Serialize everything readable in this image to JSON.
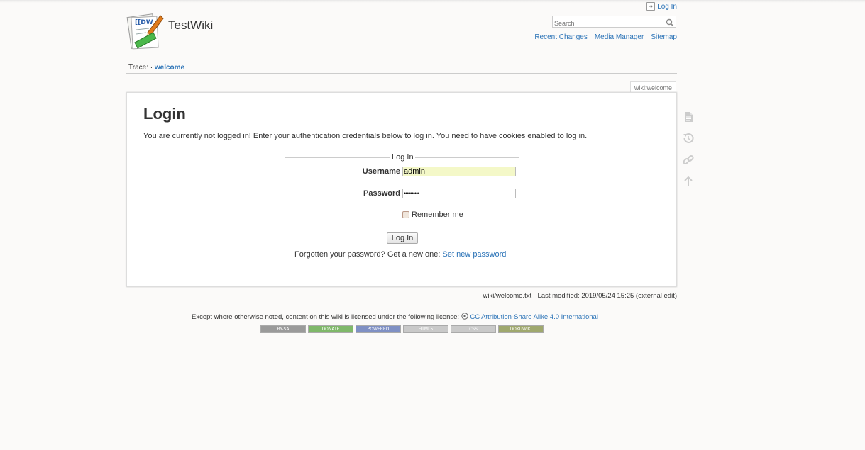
{
  "header": {
    "site_title": "TestWiki",
    "login_link": "Log In",
    "search_placeholder": "Search",
    "site_tools": [
      "Recent Changes",
      "Media Manager",
      "Sitemap"
    ]
  },
  "trace": {
    "label": "Trace:",
    "separator": "·",
    "current": "welcome"
  },
  "page": {
    "page_id": "wiki:welcome",
    "heading": "Login",
    "intro": "You are currently not logged in! Enter your authentication credentials below to log in. You need to have cookies enabled to log in.",
    "form": {
      "legend": "Log In",
      "username_label": "Username",
      "username_value": "admin",
      "password_label": "Password",
      "password_value": "••••••••••",
      "remember_label": "Remember me",
      "remember_checked": false,
      "submit_label": "Log In"
    },
    "forgot_text": "Forgotten your password? Get a new one:",
    "forgot_link": "Set new password"
  },
  "page_tools": [
    "show-page-icon",
    "old-revisions-icon",
    "backlinks-icon",
    "back-to-top-icon"
  ],
  "docinfo": "wiki/welcome.txt · Last modified: 2019/05/24 15:25 (external edit)",
  "license": {
    "text": "Except where otherwise noted, content on this wiki is licensed under the following license:",
    "link": "CC Attribution-Share Alike 4.0 International"
  },
  "badges": [
    {
      "label": "BY-SA",
      "color": "#9a9a9a"
    },
    {
      "label": "DONATE",
      "color": "#7fb86a"
    },
    {
      "label": "POWERED",
      "color": "#7f90c4"
    },
    {
      "label": "HTML5",
      "color": "#c9c9c9"
    },
    {
      "label": "CSS",
      "color": "#c9c9c9"
    },
    {
      "label": "DOKUWIKI",
      "color": "#9fa86e"
    }
  ],
  "colors": {
    "link": "#2b73b7",
    "username_bg": "#f4f8c8",
    "background": "#fbfaf9"
  }
}
